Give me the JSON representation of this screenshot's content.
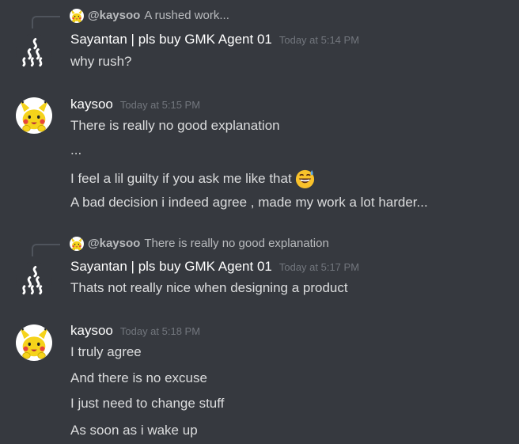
{
  "messages": [
    {
      "reply": {
        "author": "@kaysoo",
        "text": "A rushed work..."
      },
      "author": "Sayantan | pls buy GMK Agent 01",
      "timestamp": "Today at 5:14 PM",
      "avatar_icon": "steam-wave-icon",
      "lines": [
        "why rush?"
      ]
    },
    {
      "author": "kaysoo",
      "timestamp": "Today at 5:15 PM",
      "avatar_icon": "pikachu-avatar",
      "lines": [
        "There is really no good explanation",
        "...",
        "I feel a lil guilty if you ask me like that",
        "A bad decision i indeed agree , made my work a lot harder..."
      ],
      "emoji": "sweat-smile-emoji"
    },
    {
      "reply": {
        "author": "@kaysoo",
        "text": "There is really no good explanation"
      },
      "author": "Sayantan | pls buy GMK Agent 01",
      "timestamp": "Today at 5:17 PM",
      "avatar_icon": "steam-wave-icon",
      "lines": [
        "Thats not really nice when designing a product"
      ]
    },
    {
      "author": "kaysoo",
      "timestamp": "Today at 5:18 PM",
      "avatar_icon": "pikachu-avatar",
      "lines": [
        "I truly agree",
        "And there is no excuse",
        "I just need to change stuff",
        "As soon as i wake up"
      ]
    }
  ],
  "colors": {
    "background": "#36393f",
    "author": "#ffffff",
    "text": "#dcddde",
    "muted": "#72767d",
    "reply": "#b9bbbe"
  }
}
